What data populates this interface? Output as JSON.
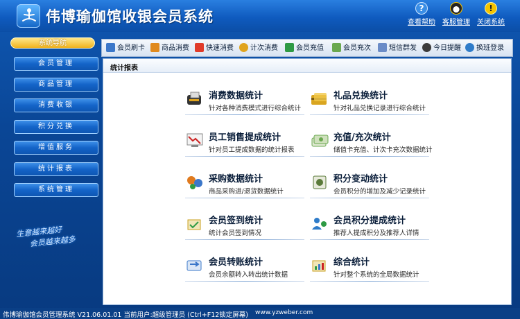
{
  "header": {
    "title": "伟博瑜伽馆收银会员系统",
    "buttons": [
      {
        "label": "查看帮助",
        "icon": "help-icon",
        "color": "#3a8ee6"
      },
      {
        "label": "客服管理",
        "icon": "penguin-icon",
        "color": "#222222"
      },
      {
        "label": "关闭系统",
        "icon": "warning-icon",
        "color": "#f5c400"
      }
    ]
  },
  "sidebar": {
    "title": "系统导航",
    "items": [
      {
        "label": "会员管理"
      },
      {
        "label": "商品管理"
      },
      {
        "label": "消费收银"
      },
      {
        "label": "积分兑换"
      },
      {
        "label": "增值服务"
      },
      {
        "label": "统计报表"
      },
      {
        "label": "系统管理"
      }
    ],
    "slogan_line1": "生意越来越好",
    "slogan_line2": "会员越来越多"
  },
  "toolbar": {
    "items": [
      {
        "label": "会员刷卡",
        "icon": "card-icon",
        "color": "#3b77c9"
      },
      {
        "label": "商品消费",
        "icon": "goods-icon",
        "color": "#e08a1e"
      },
      {
        "label": "快速消费",
        "icon": "fast-icon",
        "color": "#e03b2a"
      },
      {
        "label": "计次消费",
        "icon": "count-icon",
        "color": "#e0a41e"
      },
      {
        "label": "会员充值",
        "icon": "recharge-icon",
        "color": "#2e9a44"
      },
      {
        "label": "会员充次",
        "icon": "times-icon",
        "color": "#6aa84f"
      },
      {
        "label": "短信群发",
        "icon": "sms-icon",
        "color": "#6b8cc7"
      },
      {
        "label": "今日提醒",
        "icon": "clock-icon",
        "color": "#3b3b3b"
      },
      {
        "label": "换班登录",
        "icon": "shift-icon",
        "color": "#2f7cc9"
      }
    ]
  },
  "main": {
    "section_title": "统计报表",
    "cards": [
      {
        "title": "消费数据统计",
        "desc": "针对各种消费模式进行综合统计",
        "icon": "pos-machine-icon",
        "color": "#333333"
      },
      {
        "title": "礼品兑换统计",
        "desc": "针对礼品兑换记录进行综合统计",
        "icon": "gift-card-icon",
        "color": "#d9a520"
      },
      {
        "title": "员工销售提成统计",
        "desc": "针对员工提成数据的统计报表",
        "icon": "sales-chart-icon",
        "color": "#cc2222"
      },
      {
        "title": "充值/充次统计",
        "desc": "储值卡充值、计次卡充次数据统计",
        "icon": "money-icon",
        "color": "#6aa84f"
      },
      {
        "title": "采购数据统计",
        "desc": "商品采购进/退货数据统计",
        "icon": "purchase-icon",
        "color": "#e07a1e"
      },
      {
        "title": "积分变动统计",
        "desc": "会员积分的增加及减少记录统计",
        "icon": "points-icon",
        "color": "#5a7a3a"
      },
      {
        "title": "会员签到统计",
        "desc": "统计会员签到情况",
        "icon": "signin-icon",
        "color": "#c9a020"
      },
      {
        "title": "会员积分提成统计",
        "desc": "推荐人提成积分及推荐人详情",
        "icon": "referral-icon",
        "color": "#2f7cc9"
      },
      {
        "title": "会员转账统计",
        "desc": "会员余额转入转出统计数据",
        "icon": "transfer-icon",
        "color": "#3b77c9"
      },
      {
        "title": "综合统计",
        "desc": "针对整个系统的全局数据统计",
        "icon": "summary-icon",
        "color": "#c9a020"
      }
    ]
  },
  "statusbar": {
    "left": "伟博瑜伽馆会员管理系统 V21.06.01.01 当前用户:超级管理员 (Ctrl+F12锁定屏幕)",
    "url": "www.yzweber.com"
  }
}
